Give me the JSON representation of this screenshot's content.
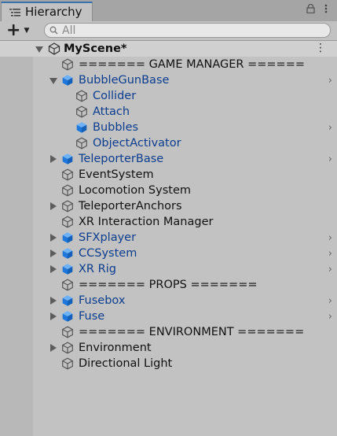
{
  "tab": {
    "title": "Hierarchy"
  },
  "search": {
    "placeholder": "All"
  },
  "scene": {
    "name": "MyScene*"
  },
  "colors": {
    "accent": "#3a72b0",
    "prefab_text": "#0b3d8f",
    "prefab_icon": "#1e78dc"
  },
  "rows": [
    {
      "label": "======= GAME MANAGER ======",
      "depth": 0,
      "fold": "none",
      "prefab": false,
      "chevron": false
    },
    {
      "label": "BubbleGunBase",
      "depth": 0,
      "fold": "open",
      "prefab": true,
      "chevron": true
    },
    {
      "label": "Collider",
      "depth": 1,
      "fold": "none",
      "prefab": true,
      "chevron": false,
      "icon": "outline"
    },
    {
      "label": "Attach",
      "depth": 1,
      "fold": "none",
      "prefab": true,
      "chevron": false,
      "icon": "outline"
    },
    {
      "label": "Bubbles",
      "depth": 1,
      "fold": "none",
      "prefab": true,
      "chevron": true
    },
    {
      "label": "ObjectActivator",
      "depth": 1,
      "fold": "none",
      "prefab": true,
      "chevron": false,
      "icon": "outline"
    },
    {
      "label": "TeleporterBase",
      "depth": 0,
      "fold": "closed",
      "prefab": true,
      "chevron": true
    },
    {
      "label": "EventSystem",
      "depth": 0,
      "fold": "none",
      "prefab": false,
      "chevron": false
    },
    {
      "label": "Locomotion System",
      "depth": 0,
      "fold": "none",
      "prefab": false,
      "chevron": false
    },
    {
      "label": "TeleporterAnchors",
      "depth": 0,
      "fold": "closed",
      "prefab": false,
      "chevron": false
    },
    {
      "label": "XR Interaction Manager",
      "depth": 0,
      "fold": "none",
      "prefab": false,
      "chevron": false
    },
    {
      "label": "SFXplayer",
      "depth": 0,
      "fold": "closed",
      "prefab": true,
      "chevron": true
    },
    {
      "label": "CCSystem",
      "depth": 0,
      "fold": "closed",
      "prefab": true,
      "chevron": true
    },
    {
      "label": "XR Rig",
      "depth": 0,
      "fold": "closed",
      "prefab": true,
      "chevron": true
    },
    {
      "label": "======= PROPS =======",
      "depth": 0,
      "fold": "none",
      "prefab": false,
      "chevron": false
    },
    {
      "label": "Fusebox",
      "depth": 0,
      "fold": "closed",
      "prefab": true,
      "chevron": true
    },
    {
      "label": "Fuse",
      "depth": 0,
      "fold": "closed",
      "prefab": true,
      "chevron": true
    },
    {
      "label": "======= ENVIRONMENT =======",
      "depth": 0,
      "fold": "none",
      "prefab": false,
      "chevron": false
    },
    {
      "label": "Environment",
      "depth": 0,
      "fold": "closed",
      "prefab": false,
      "chevron": false
    },
    {
      "label": "Directional Light",
      "depth": 0,
      "fold": "none",
      "prefab": false,
      "chevron": false
    }
  ]
}
